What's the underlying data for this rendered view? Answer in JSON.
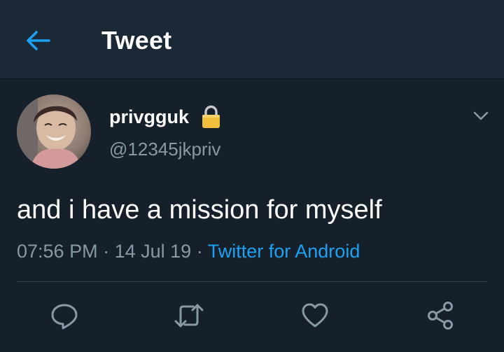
{
  "header": {
    "title": "Tweet",
    "back_icon": "arrow-left-icon"
  },
  "tweet": {
    "author_name": "privgguk",
    "author_handle": "@12345jkpriv",
    "protected_icon": "lock-icon",
    "text": "and i have a mission for myself",
    "time": "07:56 PM",
    "separator": "·",
    "date": "14 Jul 19",
    "source": "Twitter for Android"
  },
  "actions": {
    "icons": [
      "reply-icon",
      "retweet-icon",
      "like-icon",
      "share-icon"
    ]
  },
  "colors": {
    "background": "#15202b",
    "header_background": "#1b2836",
    "accent": "#1da1f2",
    "secondary_text": "#8899a6",
    "divider": "#38444d"
  }
}
